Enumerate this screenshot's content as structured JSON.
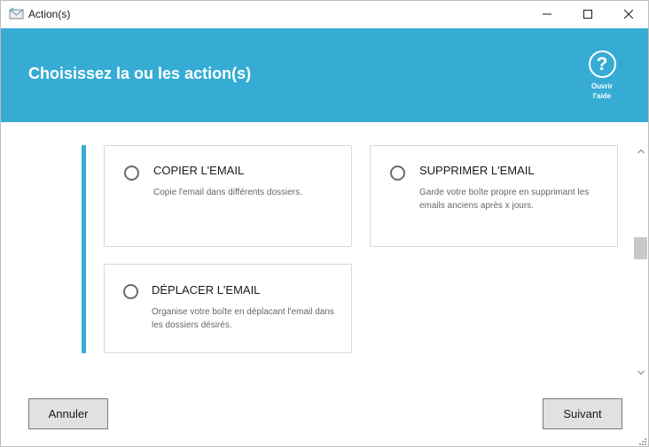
{
  "window": {
    "title": "Action(s)"
  },
  "header": {
    "title": "Choisissez la ou les action(s)",
    "help_label_line1": "Ouvrir",
    "help_label_line2": "l'aide",
    "help_symbol": "?"
  },
  "actions": [
    {
      "title": "COPIER L'EMAIL",
      "description": "Copie l'email dans différents dossiers.",
      "selected": false
    },
    {
      "title": "SUPPRIMER L'EMAIL",
      "description": "Garde votre boîte propre en supprimant les emails anciens après x jours.",
      "selected": false
    },
    {
      "title": "DÉPLACER L'EMAIL",
      "description": "Organise votre boîte en déplacant l'email dans les dossiers désirés.",
      "selected": false
    }
  ],
  "footer": {
    "cancel_label": "Annuler",
    "next_label": "Suivant"
  },
  "colors": {
    "accent": "#36acd4",
    "card_border": "#d9d9d9",
    "button_bg": "#e1e1e1"
  },
  "icons": {
    "app": "envelope-icon",
    "minimize": "minimize-icon",
    "maximize": "maximize-icon",
    "close": "close-icon",
    "help": "question-circle-icon",
    "scroll_up": "chevron-up-icon",
    "scroll_down": "chevron-down-icon"
  }
}
